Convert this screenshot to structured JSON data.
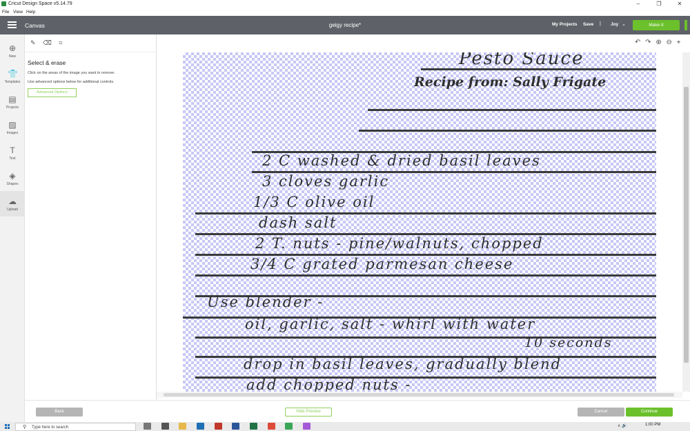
{
  "window": {
    "title": "Cricut Design Space  v5.14.79",
    "controls": [
      "–",
      "❐",
      "✕"
    ]
  },
  "menu": [
    "File",
    "View",
    "Help"
  ],
  "header": {
    "canvas_label": "Canvas",
    "project_name": "geigy recipe*",
    "my_projects": "My Projects",
    "save": "Save",
    "separator": "|",
    "user": "Joy",
    "user_chevron": "⌄",
    "make_it": "Make It"
  },
  "nav": {
    "items": [
      {
        "label": "New",
        "icon": "plus-circle-icon",
        "glyph": "⊕"
      },
      {
        "label": "Templates",
        "icon": "shirt-icon",
        "glyph": "👕"
      },
      {
        "label": "Projects",
        "icon": "projects-icon",
        "glyph": "▤"
      },
      {
        "label": "Images",
        "icon": "image-icon",
        "glyph": "▨"
      },
      {
        "label": "Text",
        "icon": "text-icon",
        "glyph": "T"
      },
      {
        "label": "Shapes",
        "icon": "shapes-icon",
        "glyph": "◈"
      },
      {
        "label": "Upload",
        "icon": "cloud-upload-icon",
        "glyph": "☁"
      }
    ]
  },
  "panel": {
    "tools": [
      "✎",
      "⌫",
      "⌗"
    ],
    "title": "Select & erase",
    "line1": "Click on the areas of the image you want to remove.",
    "line2": "Use advanced options below for additional controls.",
    "advanced_button": "Advanced Options"
  },
  "canvas_tools": [
    "↶",
    "↷",
    "⊕",
    "⊖",
    "⌖"
  ],
  "image": {
    "lines": [
      "Pesto Sauce",
      "Recipe from:  Sally Frigate",
      "2 C  washed & dried basil leaves",
      "3 cloves  garlic",
      "1/3 C  olive  oil",
      "dash  salt",
      "2 T.  nuts - pine/walnuts, chopped",
      "3/4 C  grated  parmesan  cheese",
      "Use  blender -",
      "oil, garlic, salt - whirl with water",
      "10 seconds",
      "drop in basil leaves, gradually blend",
      "add  chopped  nuts -"
    ]
  },
  "footer": {
    "back": "Back",
    "hide_preview": "Hide Preview",
    "cancel": "Cancel",
    "continue": "Continue"
  },
  "taskbar": {
    "search_placeholder": "Type here to search",
    "time": "1:00 PM",
    "tray": "∧  🔊"
  },
  "colors": {
    "header_bg": "#5e6268",
    "accent_green": "#6bc02c",
    "checker": "#c7c7f5"
  }
}
